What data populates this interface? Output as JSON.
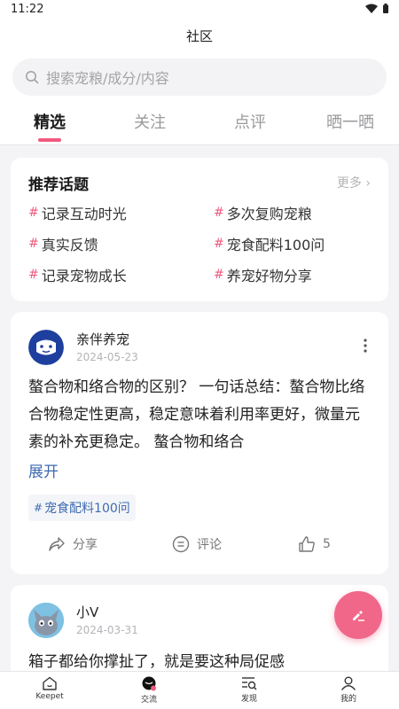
{
  "status_bar": {
    "time": "11:22"
  },
  "header": {
    "title": "社区"
  },
  "search": {
    "placeholder": "搜索宠粮/成分/内容"
  },
  "tabs": [
    {
      "label": "精选",
      "active": true
    },
    {
      "label": "关注",
      "active": false
    },
    {
      "label": "点评",
      "active": false
    },
    {
      "label": "晒一晒",
      "active": false
    }
  ],
  "topics": {
    "title": "推荐话题",
    "more": "更多",
    "items": [
      "记录互动时光",
      "多次复购宠粮",
      "真实反馈",
      "宠食配料100问",
      "记录宠物成长",
      "养宠好物分享"
    ]
  },
  "posts": [
    {
      "author": "亲伴养宠",
      "date": "2024-05-23",
      "body": "螯合物和络合物的区别？ 一句话总结：螯合物比络合物稳定性更高，稳定意味着利用率更好，微量元素的补充更稳定。 螯合物和络合",
      "expand": "展开",
      "tag": "宠食配料100问",
      "share": "分享",
      "comment": "评论",
      "likes": "5"
    },
    {
      "author": "小V",
      "date": "2024-03-31",
      "body": "箱子都给你撑扯了，就是要这种局促感"
    }
  ],
  "bottom_nav": [
    {
      "label": "Keepet"
    },
    {
      "label": "交流"
    },
    {
      "label": "发现"
    },
    {
      "label": "我的"
    }
  ],
  "colors": {
    "accent": "#f05a7e",
    "link": "#3e6bb0",
    "fab": "#f1678a"
  }
}
